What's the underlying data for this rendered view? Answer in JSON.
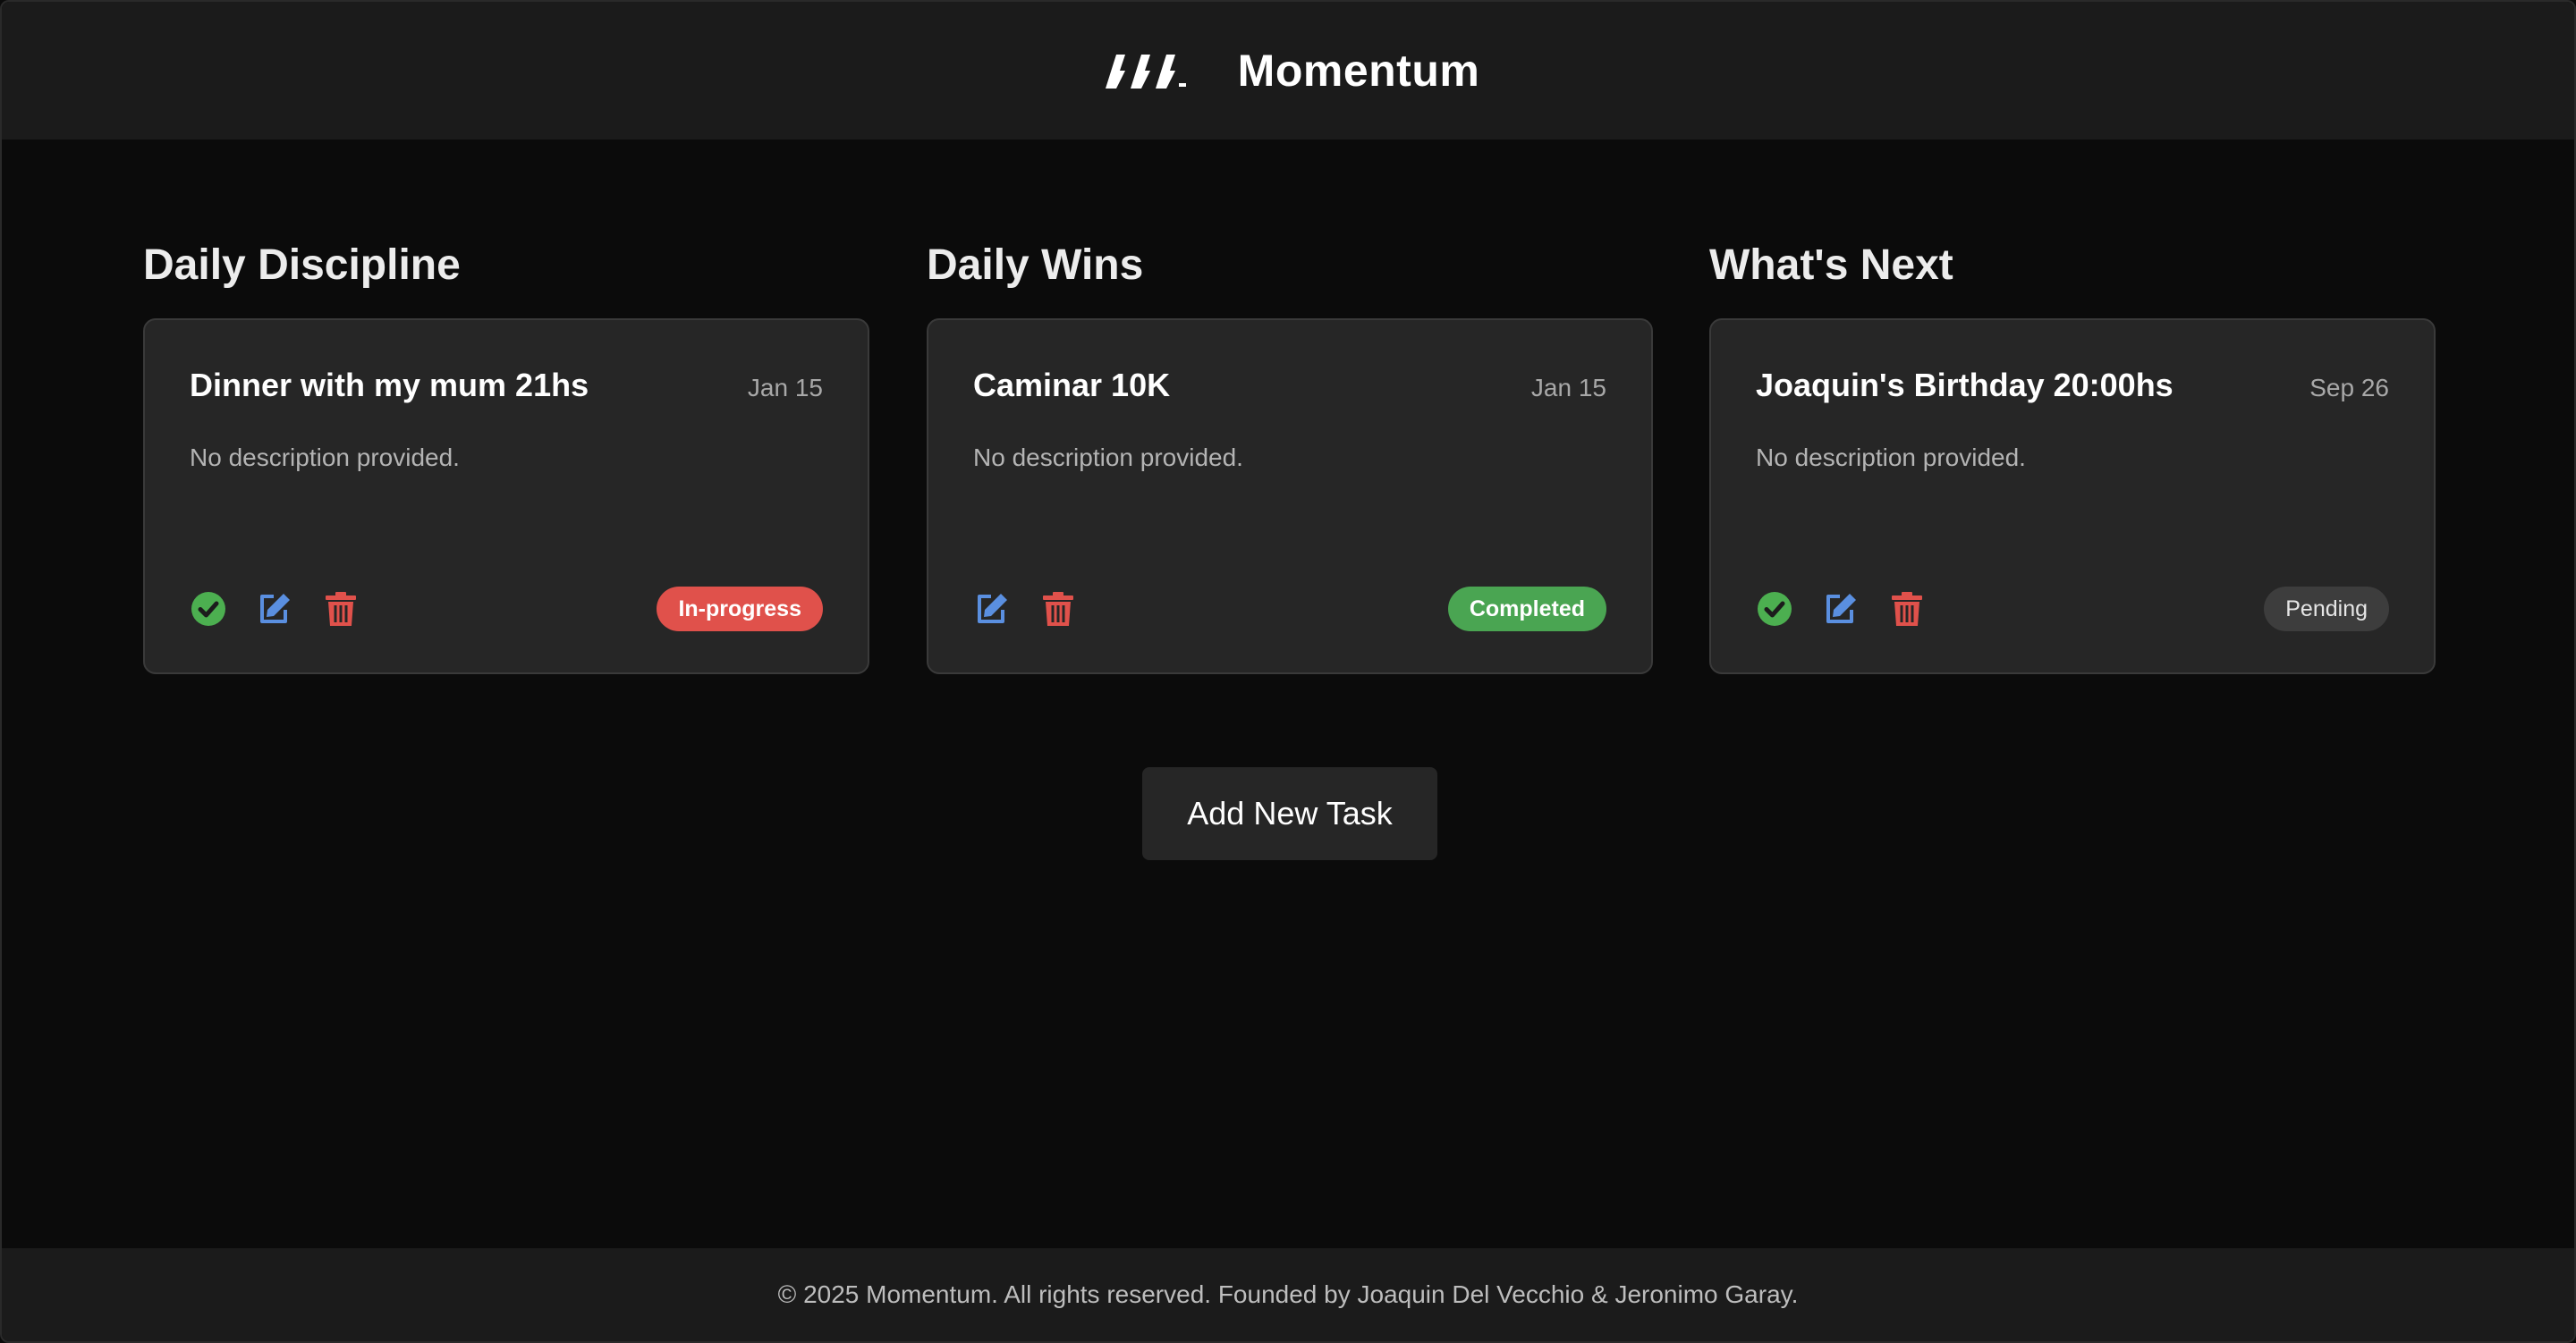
{
  "header": {
    "logo_icon": "momentum-logo-icon",
    "brand_name": "Momentum"
  },
  "columns": [
    {
      "title": "Daily Discipline",
      "task": {
        "title": "Dinner with my mum 21hs",
        "date": "Jan 15",
        "description": "No description provided.",
        "actions": [
          "check-icon",
          "edit-icon",
          "trash-icon"
        ],
        "status": "In-progress"
      }
    },
    {
      "title": "Daily Wins",
      "task": {
        "title": "Caminar 10K",
        "date": "Jan 15",
        "description": "No description provided.",
        "actions": [
          "edit-icon",
          "trash-icon"
        ],
        "status": "Completed"
      }
    },
    {
      "title": "What's Next",
      "task": {
        "title": "Joaquin's Birthday 20:00hs",
        "date": "Sep 26",
        "description": "No description provided.",
        "actions": [
          "check-icon",
          "edit-icon",
          "trash-icon"
        ],
        "status": "Pending"
      }
    }
  ],
  "add_task_label": "Add New Task",
  "footer": {
    "text": "© 2025 Momentum. All rights reserved. Founded by Joaquin Del Vecchio & Jeronimo Garay."
  },
  "colors": {
    "background": "#0b0b0b",
    "header_footer": "#1b1b1b",
    "card": "#262626",
    "check": "#4caf50",
    "edit": "#5a8fe0",
    "delete": "#e0514b",
    "in_progress": "#e0514b",
    "completed": "#4aa552",
    "pending": "#3d3d3d"
  }
}
